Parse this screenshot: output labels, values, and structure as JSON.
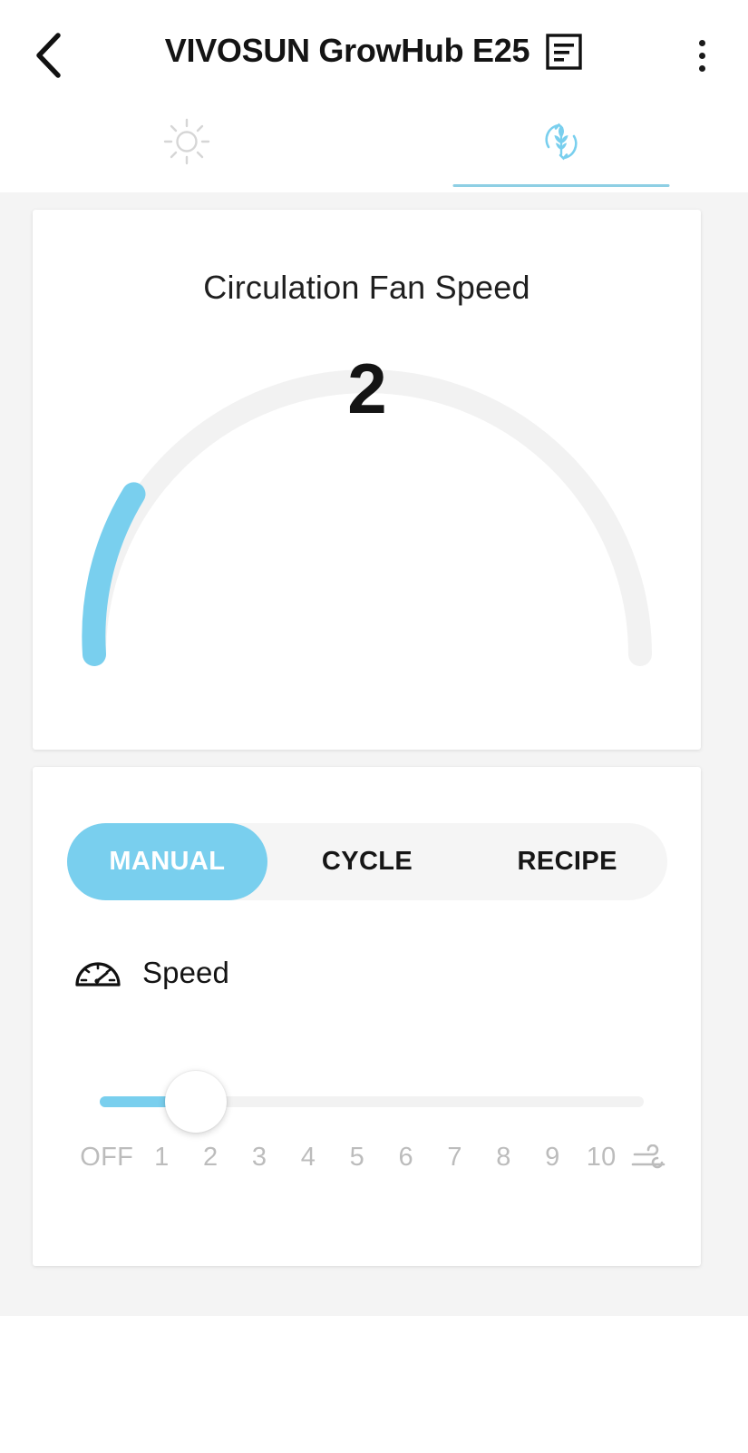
{
  "header": {
    "back_icon": "chevron-left-icon",
    "title": "VIVOSUN GrowHub E25",
    "doc_icon": "document-list-icon",
    "menu_icon": "kebab-menu-icon"
  },
  "tabs": [
    {
      "name": "light",
      "icon": "sun-icon",
      "active": false
    },
    {
      "name": "circulation",
      "icon": "leaf-recycle-icon",
      "active": true
    }
  ],
  "gauge_card": {
    "title": "Circulation Fan Speed",
    "value": "2",
    "min": 0,
    "max": 10,
    "fill_color": "#79cfee",
    "track_color": "#f2f2f2"
  },
  "control_card": {
    "modes": [
      {
        "label": "MANUAL",
        "active": true
      },
      {
        "label": "CYCLE",
        "active": false
      },
      {
        "label": "RECIPE",
        "active": false
      }
    ],
    "speed": {
      "icon": "speedometer-icon",
      "label": "Speed",
      "value": 2,
      "min": 0,
      "max": 10,
      "ticks": [
        "OFF",
        "1",
        "2",
        "3",
        "4",
        "5",
        "6",
        "7",
        "8",
        "9",
        "10"
      ],
      "end_icon": "wind-icon"
    }
  },
  "colors": {
    "accent": "#79cfee",
    "accent_underline": "#8ecfe4",
    "page_background": "#f4f4f4",
    "card_background": "#ffffff",
    "text_primary": "#141414",
    "text_muted": "#bcbcbc",
    "tab_inactive": "#d4d4d4"
  }
}
